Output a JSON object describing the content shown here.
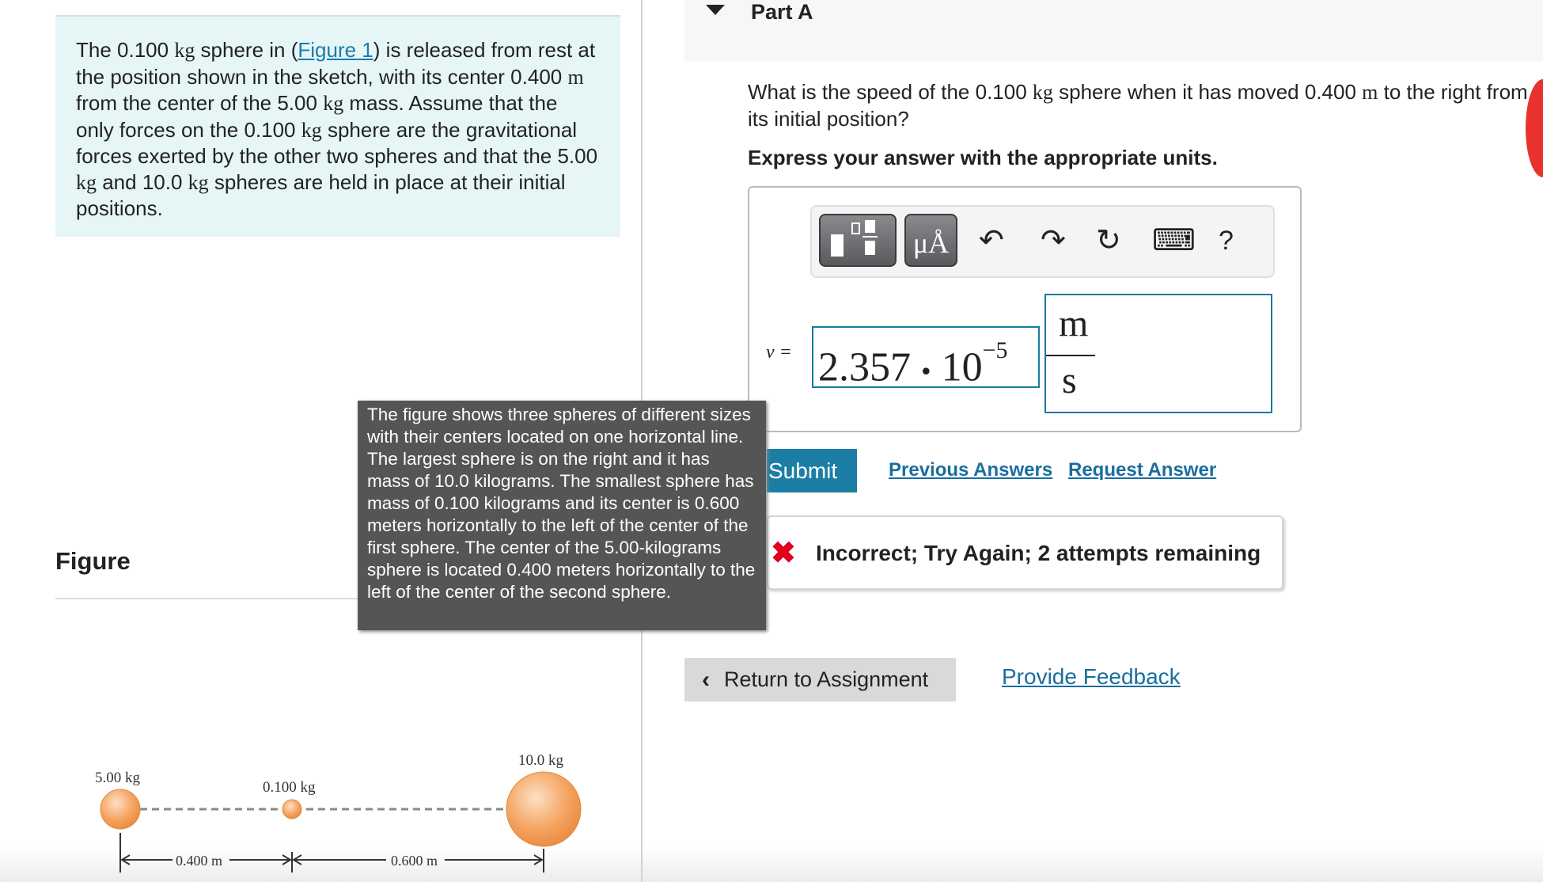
{
  "problem": {
    "text_parts": [
      "The 0.100 ",
      "kg",
      " sphere in (",
      "Figure 1",
      ") is released from rest at the position shown in the sketch, with its center 0.400 ",
      "m",
      " from the center of the 5.00 ",
      "kg",
      " mass. Assume that the only forces on the 0.100 ",
      "kg",
      " sphere are the gravitational forces exerted by the other two spheres and that the 5.00 ",
      "kg",
      " and 10.0 ",
      "kg",
      " spheres are held in place at their initial positions."
    ]
  },
  "part": {
    "title": "Part A",
    "question_parts": [
      "What is the speed of the 0.100 ",
      "kg",
      " sphere when it has moved 0.400 ",
      "m",
      " to the right from its initial position?"
    ],
    "instruction": "Express your answer with the appropriate units."
  },
  "toolbar": {
    "templates_icon": "templates-icon",
    "units_label": "μÅ",
    "undo": "↶",
    "redo": "↷",
    "reset": "↻",
    "keyboard": "⌨",
    "help": "?"
  },
  "answer": {
    "variable": "v =",
    "mantissa": "2.357",
    "dot": "•",
    "base": "10",
    "exponent": "−5",
    "unit_numerator": "m",
    "unit_denominator": "s"
  },
  "actions": {
    "submit": "Submit",
    "previous": "Previous Answers",
    "request": "Request Answer"
  },
  "feedback": {
    "icon": "✖",
    "text": "Incorrect; Try Again; 2 attempts remaining",
    "color": "#e0001b"
  },
  "nav": {
    "return": "Return to Assignment",
    "provide_feedback": "Provide Feedback"
  },
  "figure": {
    "label": "Figure",
    "tooltip": "The figure shows three spheres of different sizes with their centers located on one horizontal line. The largest sphere is on the right and it has mass of 10.0 kilograms. The smallest sphere has mass of 0.100 kilograms and its center is 0.600 meters horizontally to the left of the center of the first sphere. The center of the 5.00-kilograms sphere is located 0.400 meters horizontally to the left of the center of the second sphere.",
    "m1": "5.00 kg",
    "m2": "0.100 kg",
    "m3": "10.0 kg",
    "d1": "0.400 m",
    "d2": "0.600 m"
  },
  "colors": {
    "accent": "#1c7ea4",
    "sphere": "#f5a461"
  }
}
